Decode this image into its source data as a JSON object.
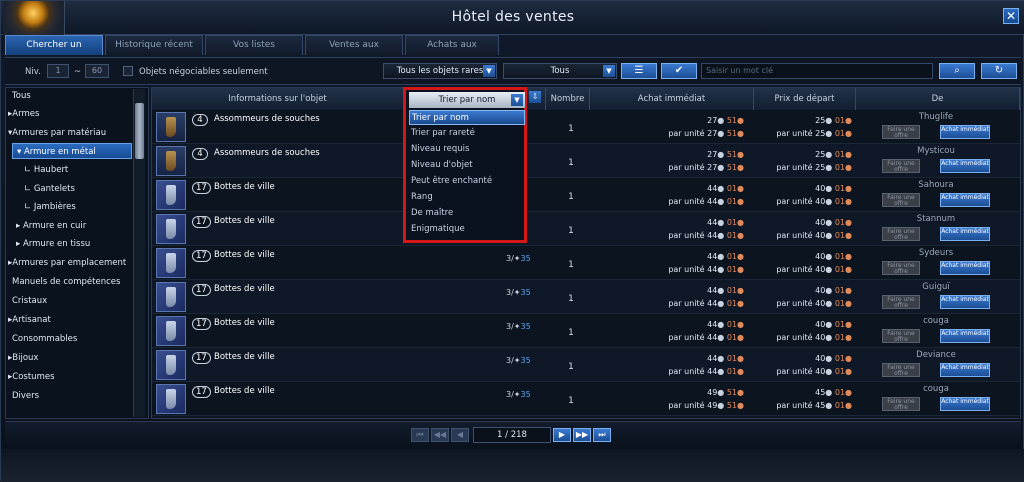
{
  "window": {
    "title": "Hôtel des ventes",
    "close": "✕"
  },
  "tabs": [
    "Chercher un objet",
    "Historique récent",
    "Vos listes",
    "Ventes aux enchères",
    "Achats aux enchères"
  ],
  "filters": {
    "niv_label": "Niv.",
    "niv_min": "1",
    "niv_sep": "~",
    "niv_max": "60",
    "tradable_label": "Objets négociables seulement",
    "rarity": "Tous les objets rares",
    "category": "Tous",
    "search_placeholder": "Saisir un mot clé"
  },
  "sidebar": [
    "Tous",
    "Armes",
    "Armures par matériau",
    "Armure en métal",
    "Haubert",
    "Gantelets",
    "Jambières",
    "Armure en cuir",
    "Armure en tissu",
    "Armures par emplacement",
    "Manuels de compétences",
    "Cristaux",
    "Artisanat",
    "Consommables",
    "Bijoux",
    "Costumes",
    "Divers"
  ],
  "sort": {
    "label": "Trier par nom",
    "options": [
      "Trier par nom",
      "Trier par rareté",
      "Niveau requis",
      "Niveau d'objet",
      "Peut être enchanté",
      "Rang",
      "De maître",
      "Enigmatique"
    ]
  },
  "columns": {
    "info": "Informations sur l'objet",
    "qty": "Nombre",
    "buyout": "Achat immédiat",
    "start": "Prix de départ",
    "seller": "De"
  },
  "unit_prefix": "par unité",
  "offer_label": "Faire une offre",
  "buy_label": "Achat immédiat",
  "rows": [
    {
      "level": "4",
      "name": "Assommeurs de souches",
      "dur": "11",
      "qty": "1",
      "buy_g": "27",
      "buy_s": "51",
      "start_g": "25",
      "start_s": "01",
      "seller": "Thuglife",
      "icon": "leather-boots-icon"
    },
    {
      "level": "4",
      "name": "Assommeurs de souches",
      "dur": "11",
      "qty": "1",
      "buy_g": "27",
      "buy_s": "51",
      "start_g": "25",
      "start_s": "01",
      "seller": "Mysticou",
      "icon": "leather-boots-icon"
    },
    {
      "level": "17",
      "name": "Bottes de ville",
      "dur": "35",
      "qty": "1",
      "buy_g": "44",
      "buy_s": "01",
      "start_g": "40",
      "start_s": "01",
      "seller": "Sahoura",
      "icon": "plate-boots-icon"
    },
    {
      "level": "17",
      "name": "Bottes de ville",
      "dur": "35",
      "qty": "1",
      "buy_g": "44",
      "buy_s": "01",
      "start_g": "40",
      "start_s": "01",
      "seller": "Stannum",
      "icon": "plate-boots-icon"
    },
    {
      "level": "17",
      "name": "Bottes de ville",
      "durpre": "3/",
      "dur": "35",
      "qty": "1",
      "buy_g": "44",
      "buy_s": "01",
      "start_g": "40",
      "start_s": "01",
      "seller": "Sydeurs",
      "icon": "plate-boots-icon"
    },
    {
      "level": "17",
      "name": "Bottes de ville",
      "durpre": "3/",
      "dur": "35",
      "qty": "1",
      "buy_g": "44",
      "buy_s": "01",
      "start_g": "40",
      "start_s": "01",
      "seller": "Guiguï",
      "icon": "plate-boots-icon"
    },
    {
      "level": "17",
      "name": "Bottes de ville",
      "durpre": "3/",
      "dur": "35",
      "qty": "1",
      "buy_g": "44",
      "buy_s": "01",
      "start_g": "40",
      "start_s": "01",
      "seller": "couga",
      "icon": "plate-boots-icon"
    },
    {
      "level": "17",
      "name": "Bottes de ville",
      "durpre": "3/",
      "dur": "35",
      "qty": "1",
      "buy_g": "44",
      "buy_s": "01",
      "start_g": "40",
      "start_s": "01",
      "seller": "Deviance",
      "icon": "plate-boots-icon"
    },
    {
      "level": "17",
      "name": "Bottes de ville",
      "durpre": "3/",
      "dur": "35",
      "qty": "1",
      "buy_g": "49",
      "buy_s": "51",
      "start_g": "45",
      "start_s": "01",
      "seller": "couga",
      "icon": "plate-boots-icon"
    }
  ],
  "pager": "1 / 218"
}
